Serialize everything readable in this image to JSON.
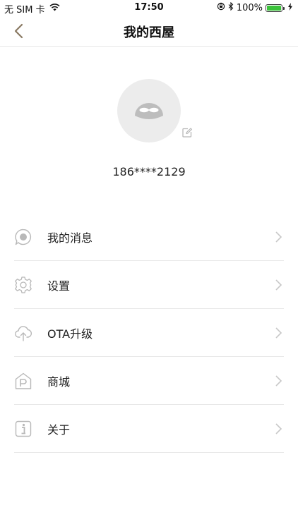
{
  "status_bar": {
    "carrier": "无 SIM 卡",
    "time": "17:50",
    "battery": "100%",
    "battery_level": 1.0
  },
  "nav": {
    "title": "我的西屋"
  },
  "profile": {
    "phone": "186****2129"
  },
  "menu": {
    "items": [
      {
        "label": "我的消息",
        "icon": "message-icon"
      },
      {
        "label": "设置",
        "icon": "gear-icon"
      },
      {
        "label": "OTA升级",
        "icon": "cloud-upload-icon"
      },
      {
        "label": "商城",
        "icon": "store-icon"
      },
      {
        "label": "关于",
        "icon": "info-icon"
      }
    ]
  },
  "colors": {
    "back_arrow": "#8a7a63",
    "icon_gray": "#b8b8b8",
    "chevron": "#c8c8c8",
    "battery_green": "#3bc23b"
  }
}
